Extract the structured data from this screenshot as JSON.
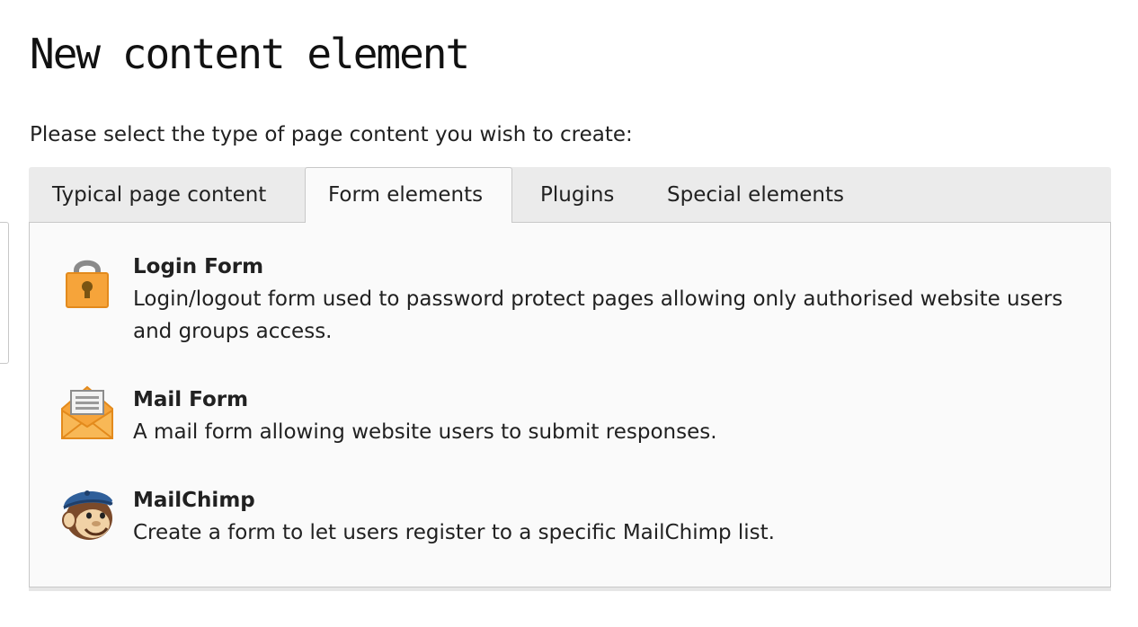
{
  "page": {
    "title": "New content element",
    "intro": "Please select the type of page content you wish to create:"
  },
  "tabs": [
    {
      "label": "Typical page content",
      "active": false
    },
    {
      "label": "Form elements",
      "active": true
    },
    {
      "label": "Plugins",
      "active": false
    },
    {
      "label": "Special elements",
      "active": false
    }
  ],
  "items": [
    {
      "icon": "lock-icon",
      "title": "Login Form",
      "description": "Login/logout form used to password protect pages allowing only authorised website users and groups access."
    },
    {
      "icon": "envelope-icon",
      "title": "Mail Form",
      "description": "A mail form allowing website users to submit responses."
    },
    {
      "icon": "mailchimp-icon",
      "title": "MailChimp",
      "description": "Create a form to let users register to a specific MailChimp list."
    }
  ],
  "colors": {
    "tab_bar_bg": "#ebebeb",
    "panel_bg": "#fafafa",
    "border": "#c8c8c8",
    "icon_orange": "#f6a43a",
    "text": "#212121"
  }
}
